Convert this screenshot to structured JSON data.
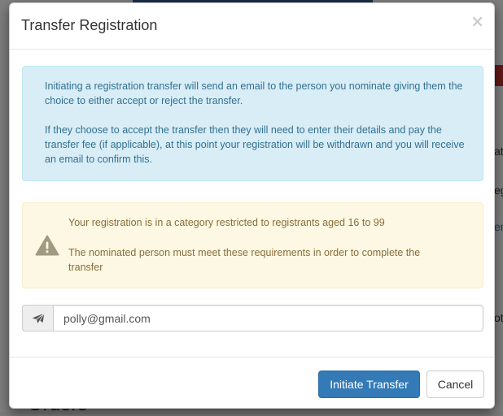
{
  "background": {
    "side_fragments": [
      "ata",
      "eg",
      "en",
      "ot"
    ],
    "section_heading": "Orders"
  },
  "modal": {
    "title": "Transfer Registration",
    "close_symbol": "×",
    "info_alert": {
      "paragraph_1": "Initiating a registration transfer will send an email to the person you nominate giving them the choice to either accept or reject the transfer.",
      "paragraph_2": "If they choose to accept the transfer then they will need to enter their details and pay the transfer fee (if applicable), at this point your registration will be withdrawn and you will receive an email to confirm this."
    },
    "warning_alert": {
      "icon": "warning-triangle-icon",
      "line_1": "Your registration is in a category restricted to registrants aged 16 to 99",
      "line_2": "The nominated person must meet these requirements in order to complete the transfer"
    },
    "email_field": {
      "icon": "paper-plane-icon",
      "value": "polly@gmail.com",
      "placeholder": ""
    },
    "footer": {
      "primary_button": "Initiate Transfer",
      "cancel_button": "Cancel"
    }
  },
  "colors": {
    "primary": "#337ab7",
    "info_bg": "#d9edf7",
    "info_text": "#31708f",
    "warning_bg": "#fcf8e3",
    "warning_text": "#8a6d3b"
  }
}
